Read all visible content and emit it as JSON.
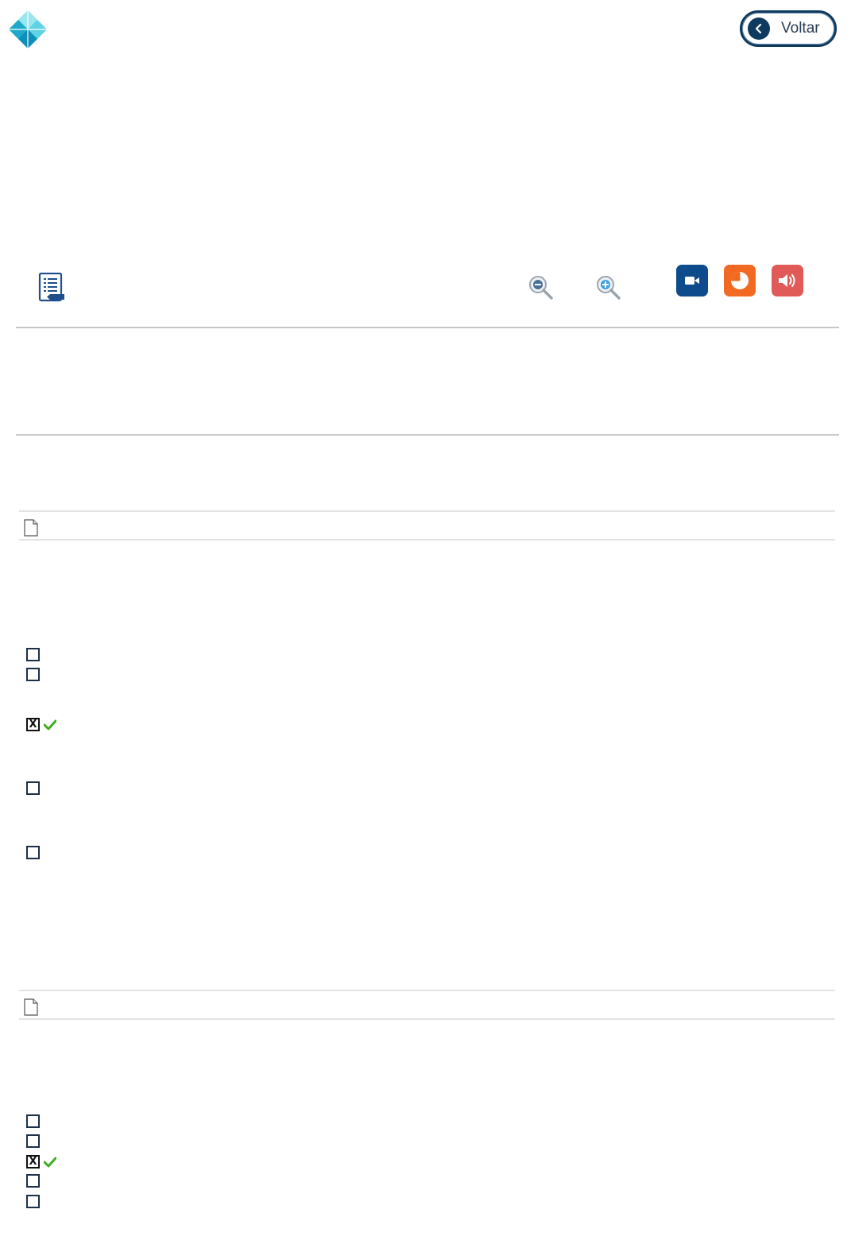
{
  "header": {
    "logo_icon": "diamond-logo-icon",
    "back_button": {
      "label": "Voltar",
      "icon": "chevron-left-icon"
    }
  },
  "toolbar": {
    "summary_icon": "document-list-icon",
    "zoom_out_icon": "zoom-out-icon",
    "zoom_in_icon": "zoom-in-icon",
    "media_buttons": [
      {
        "name": "video-icon",
        "color": "#0d4b8c"
      },
      {
        "name": "pie-chart-icon",
        "color": "#f26a21"
      },
      {
        "name": "audio-icon",
        "color": "#e05b58"
      }
    ]
  },
  "questions": [
    {
      "doc_icon": "blank-document-icon",
      "options": [
        {
          "checked": false,
          "correct": false,
          "mark": ""
        },
        {
          "checked": false,
          "correct": false,
          "mark": ""
        },
        {
          "checked": true,
          "correct": true,
          "mark": "X"
        },
        {
          "checked": false,
          "correct": false,
          "mark": ""
        },
        {
          "checked": false,
          "correct": false,
          "mark": ""
        }
      ]
    },
    {
      "doc_icon": "blank-document-icon",
      "options": [
        {
          "checked": false,
          "correct": false,
          "mark": ""
        },
        {
          "checked": false,
          "correct": false,
          "mark": ""
        },
        {
          "checked": true,
          "correct": true,
          "mark": "X"
        },
        {
          "checked": false,
          "correct": false,
          "mark": ""
        },
        {
          "checked": false,
          "correct": false,
          "mark": ""
        }
      ]
    }
  ]
}
